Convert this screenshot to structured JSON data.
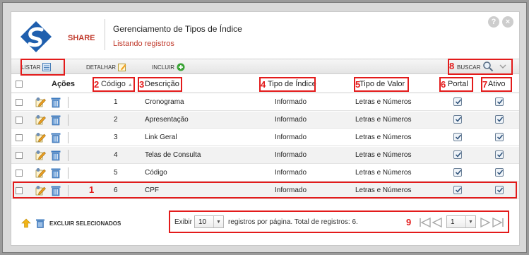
{
  "header": {
    "brand": "SHARE",
    "title": "Gerenciamento de Tipos de Índice",
    "subtitle": "Listando registros"
  },
  "toolbar": {
    "listar": "LISTAR",
    "detalhar": "DETALHAR",
    "incluir": "INCLUIR",
    "buscar": "BUSCAR"
  },
  "columns": {
    "acoes": "Ações",
    "codigo": "Código",
    "descricao": "Descrição",
    "tipo_indice": "Tipo de Índice",
    "tipo_valor": "Tipo de Valor",
    "portal": "Portal",
    "ativo": "Ativo"
  },
  "rows": [
    {
      "codigo": "1",
      "descricao": "Cronograma",
      "tipo_indice": "Informado",
      "tipo_valor": "Letras e Números",
      "portal": true,
      "ativo": true
    },
    {
      "codigo": "2",
      "descricao": "Apresentação",
      "tipo_indice": "Informado",
      "tipo_valor": "Letras e Números",
      "portal": true,
      "ativo": true
    },
    {
      "codigo": "3",
      "descricao": "Link Geral",
      "tipo_indice": "Informado",
      "tipo_valor": "Letras e Números",
      "portal": true,
      "ativo": true
    },
    {
      "codigo": "4",
      "descricao": "Telas de Consulta",
      "tipo_indice": "Informado",
      "tipo_valor": "Letras e Números",
      "portal": true,
      "ativo": true
    },
    {
      "codigo": "5",
      "descricao": "Código",
      "tipo_indice": "Informado",
      "tipo_valor": "Letras e Números",
      "portal": true,
      "ativo": true
    },
    {
      "codigo": "6",
      "descricao": "CPF",
      "tipo_indice": "Informado",
      "tipo_valor": "Letras e Números",
      "portal": true,
      "ativo": true
    }
  ],
  "footer": {
    "excluir": "EXCLUIR SELECIONADOS",
    "exibir": "Exibir",
    "per_page": "10",
    "registros": "registros por página. Total de registros: 6.",
    "page": "1"
  },
  "annotations": {
    "n1": "1",
    "n2": "2",
    "n3": "3",
    "n4": "4",
    "n5": "5",
    "n6": "6",
    "n7": "7",
    "n8": "8",
    "n9": "9"
  },
  "colors": {
    "annotation_red": "#e31b1b",
    "brand_red": "#c0392b",
    "icon_blue": "#2a6db5",
    "add_green": "#3aa335"
  }
}
